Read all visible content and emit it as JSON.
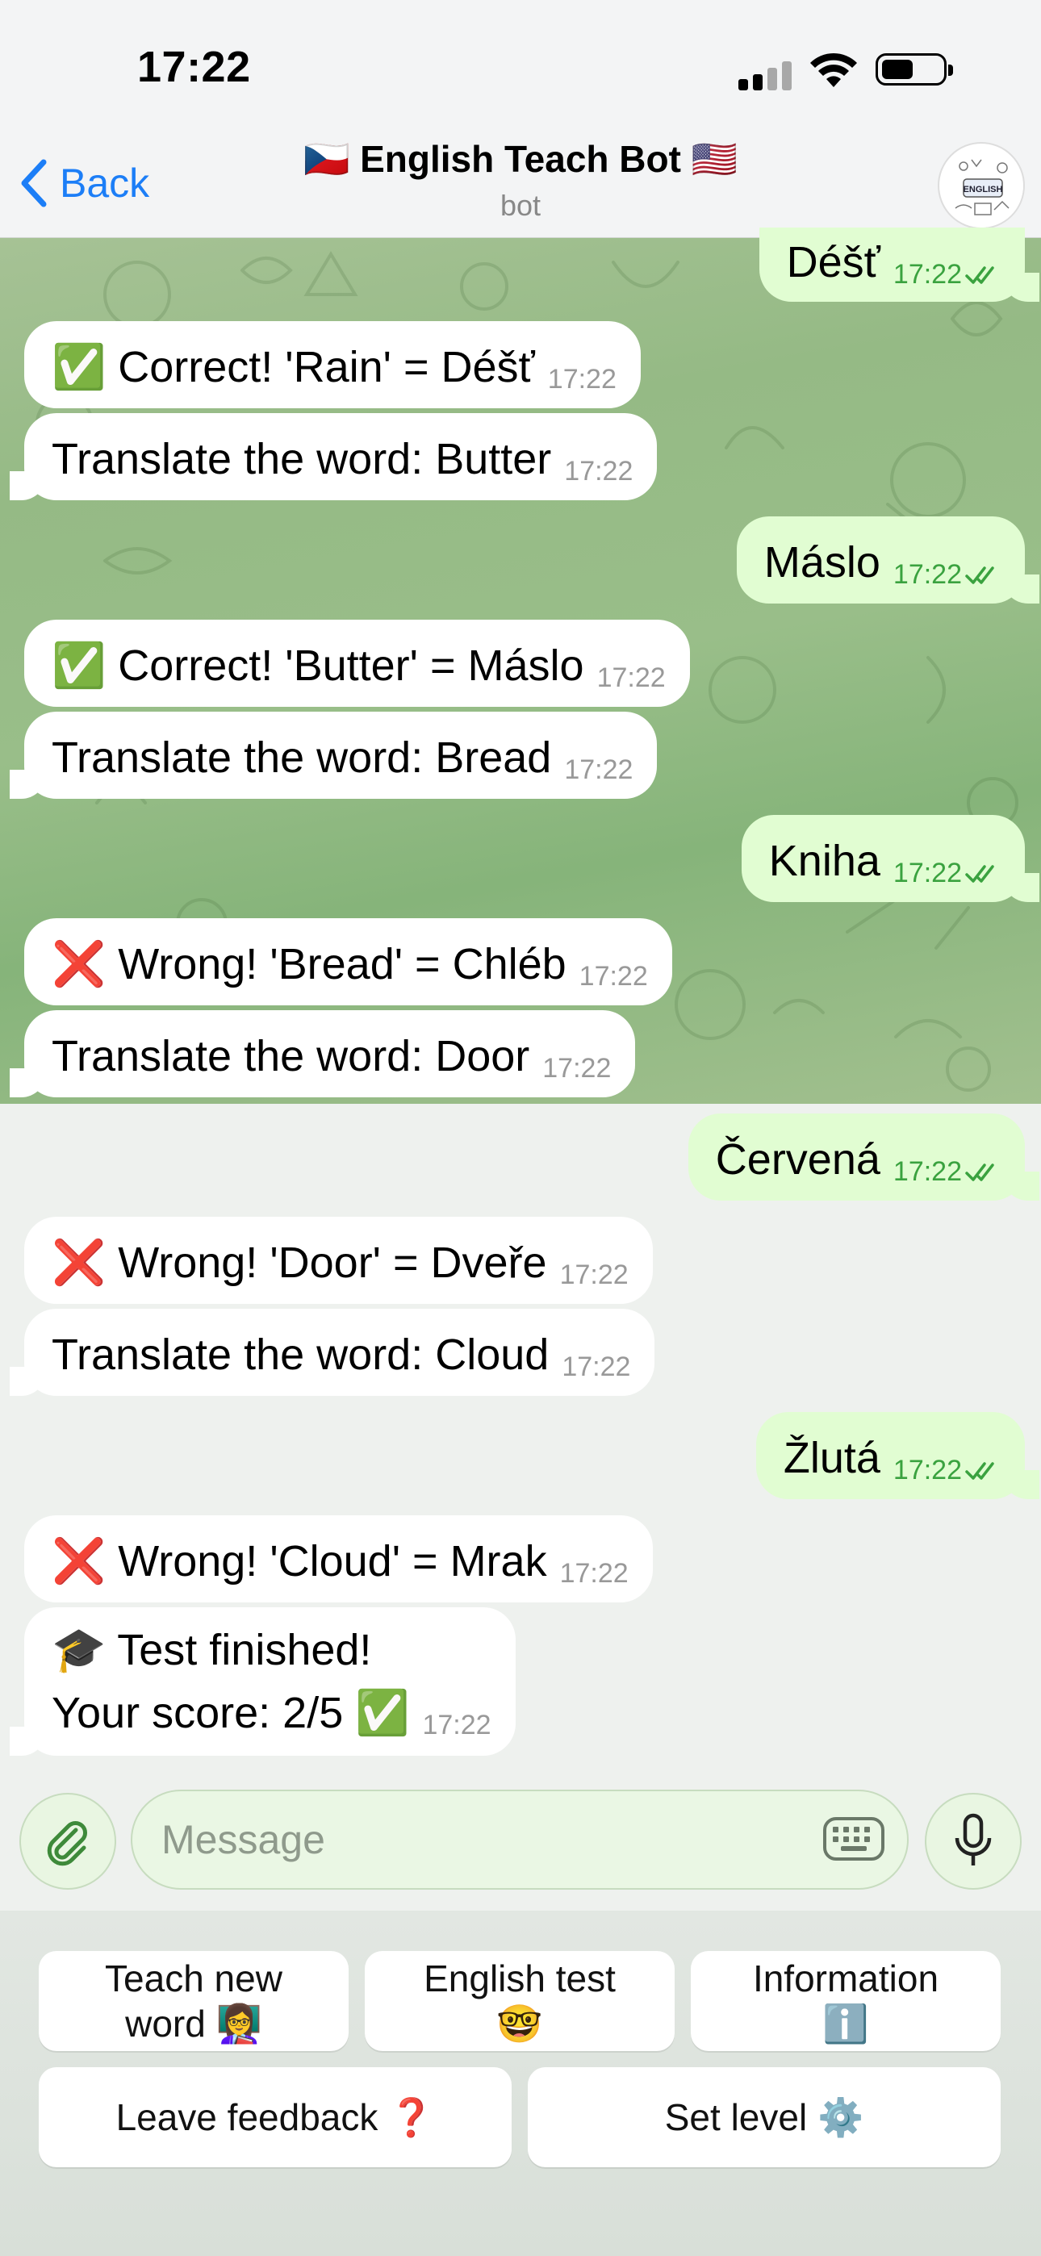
{
  "status_bar": {
    "time": "17:22"
  },
  "header": {
    "back_label": "Back",
    "title": "🇨🇿 English Teach Bot 🇺🇸",
    "subtitle": "bot",
    "avatar_text": "ENGLISH"
  },
  "messages": [
    {
      "type": "out",
      "text": "Déšť",
      "time": "17:22"
    },
    {
      "type": "in",
      "text": "✅ Correct! 'Rain' = Déšť",
      "time": "17:22"
    },
    {
      "type": "in",
      "text": "Translate the word: Butter",
      "time": "17:22"
    },
    {
      "type": "out",
      "text": "Máslo",
      "time": "17:22"
    },
    {
      "type": "in",
      "text": "✅ Correct! 'Butter' = Máslo",
      "time": "17:22"
    },
    {
      "type": "in",
      "text": "Translate the word: Bread",
      "time": "17:22"
    },
    {
      "type": "out",
      "text": "Kniha",
      "time": "17:22"
    },
    {
      "type": "in",
      "text": "❌ Wrong! 'Bread' = Chléb",
      "time": "17:22"
    },
    {
      "type": "in",
      "text": "Translate the word: Door",
      "time": "17:22"
    },
    {
      "type": "out",
      "text": "Červená",
      "time": "17:22"
    },
    {
      "type": "in",
      "text": "❌ Wrong! 'Door' = Dveře",
      "time": "17:22"
    },
    {
      "type": "in",
      "text": "Translate the word: Cloud",
      "time": "17:22"
    },
    {
      "type": "out",
      "text": "Žlutá",
      "time": "17:22"
    },
    {
      "type": "in",
      "text": "❌ Wrong! 'Cloud' = Mrak",
      "time": "17:22"
    },
    {
      "type": "in",
      "line1": "🎓 Test finished!",
      "line2": "Your score: 2/5 ✅",
      "time": "17:22"
    }
  ],
  "composer": {
    "placeholder": "Message"
  },
  "keyboard": {
    "teach": "Teach new word 👩‍🏫",
    "teach_l1": "Teach new",
    "teach_l2": "word 👩‍🏫",
    "test_l1": "English test",
    "test_l2": "🤓",
    "info_l1": "Information",
    "info_l2": "ℹ️",
    "feedback": "Leave feedback ❓",
    "level": "Set level ⚙️"
  }
}
